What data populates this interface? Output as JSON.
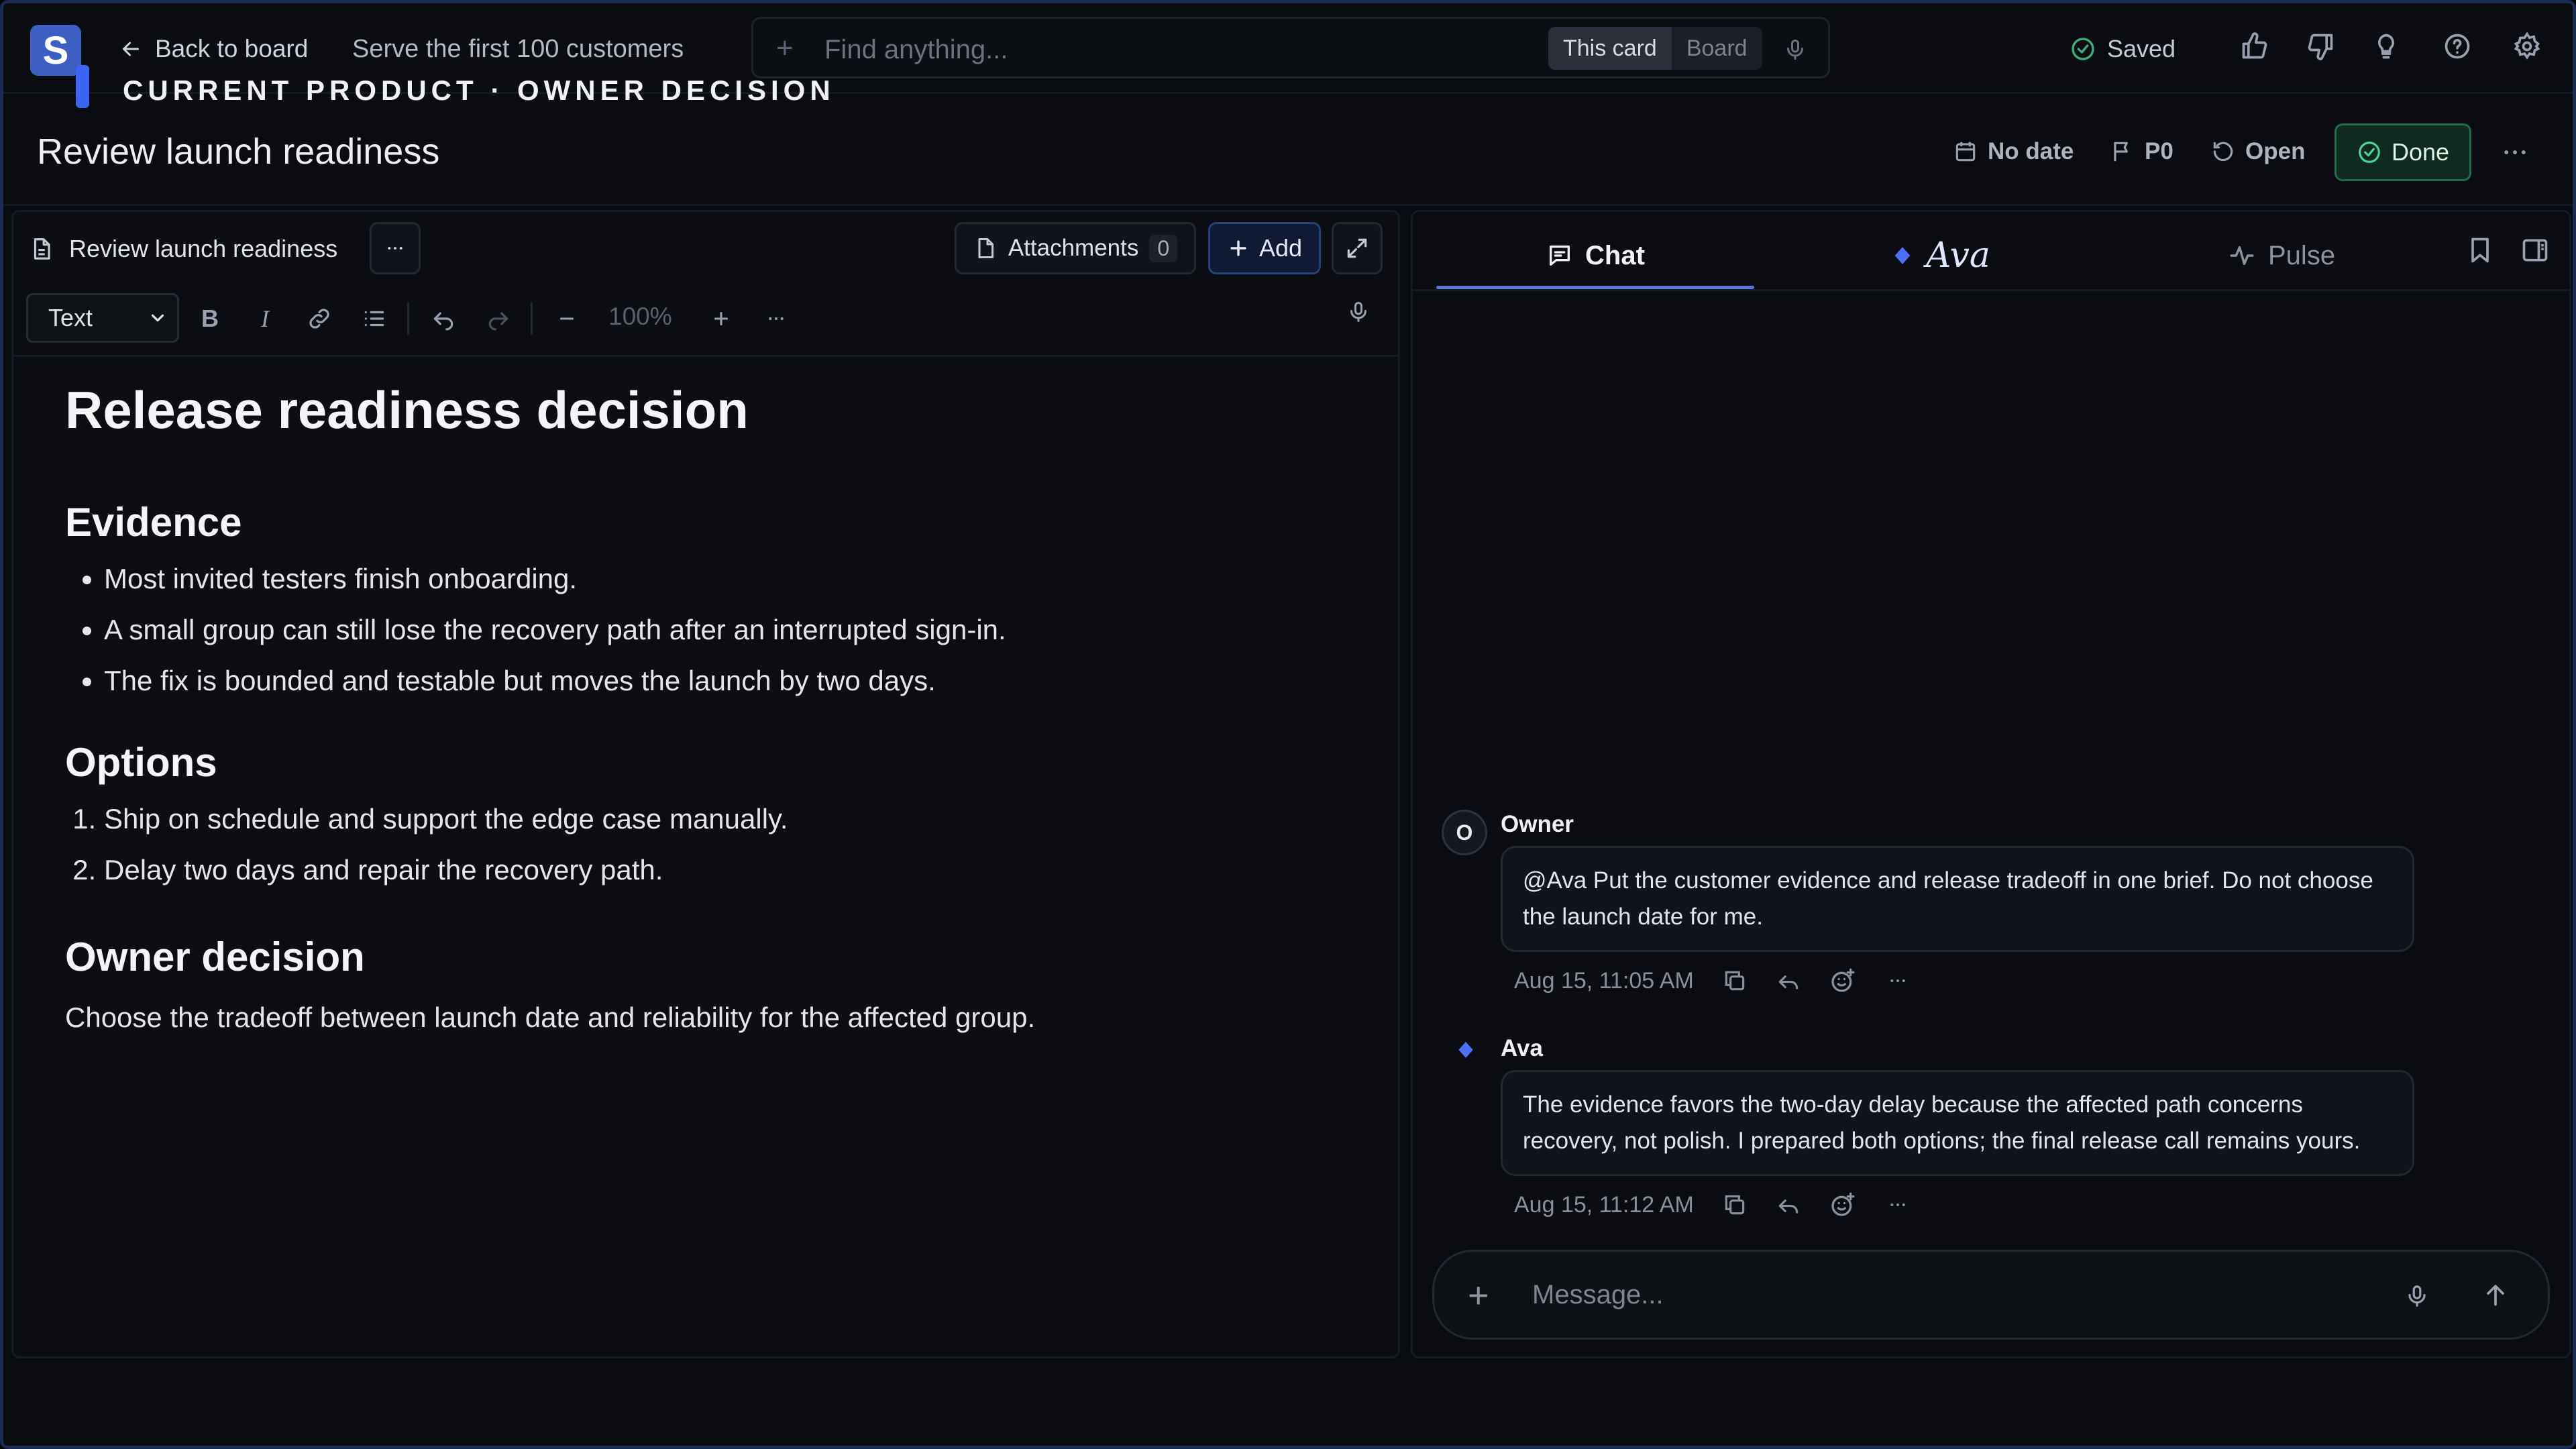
{
  "topbar": {
    "logo_letter": "S",
    "back_label": "Back to board",
    "breadcrumb": "Serve the first 100 customers",
    "eyebrow": "CURRENT PRODUCT · OWNER DECISION",
    "search_placeholder": "Find anything...",
    "scope_options": [
      "This card",
      "Board"
    ],
    "scope_selected": "This card",
    "saved_label": "Saved",
    "icons": [
      "thumbs-up-icon",
      "thumbs-down-icon",
      "lightbulb-icon",
      "help-icon",
      "settings-icon"
    ]
  },
  "card": {
    "title": "Review launch readiness",
    "date_label": "No date",
    "priority_label": "P0",
    "status_label": "Open",
    "done_label": "Done"
  },
  "editor": {
    "doc_tab_label": "Review launch readiness",
    "attachments_label": "Attachments",
    "attachments_count": "0",
    "add_label": "Add",
    "format_selected": "Text",
    "zoom_label": "100%"
  },
  "document": {
    "heading": "Release readiness decision",
    "sections": [
      {
        "heading": "Evidence",
        "bullets": [
          "Most invited testers finish onboarding.",
          "A small group can still lose the recovery path after an interrupted sign-in.",
          "The fix is bounded and testable but moves the launch by two days."
        ]
      },
      {
        "heading": "Options",
        "numbered": [
          "Ship on schedule and support the edge case manually.",
          "Delay two days and repair the recovery path."
        ]
      },
      {
        "heading": "Owner decision",
        "text": "Choose the tradeoff between launch date and reliability for the affected group."
      }
    ]
  },
  "chat": {
    "tabs": [
      {
        "label": "Chat",
        "icon": "chat-icon"
      },
      {
        "label": "Ava",
        "icon": "diamond-icon"
      },
      {
        "label": "Pulse",
        "icon": "pulse-icon"
      }
    ],
    "active_tab": "Chat",
    "messages": [
      {
        "author": "Owner",
        "avatar": "O",
        "text": "@Ava Put the customer evidence and release tradeoff in one brief. Do not choose the launch date for me.",
        "time": "Aug 15, 11:05 AM"
      },
      {
        "author": "Ava",
        "avatar_icon": "diamond-icon",
        "text": "The evidence favors the two-day delay because the affected path concerns recovery, not polish. I prepared both options; the final release call remains yours.",
        "time": "Aug 15, 11:12 AM"
      }
    ],
    "composer_placeholder": "Message..."
  },
  "colors": {
    "accent": "#3b66f5",
    "done_green": "#1f6b4b",
    "background": "#0a0c11"
  }
}
